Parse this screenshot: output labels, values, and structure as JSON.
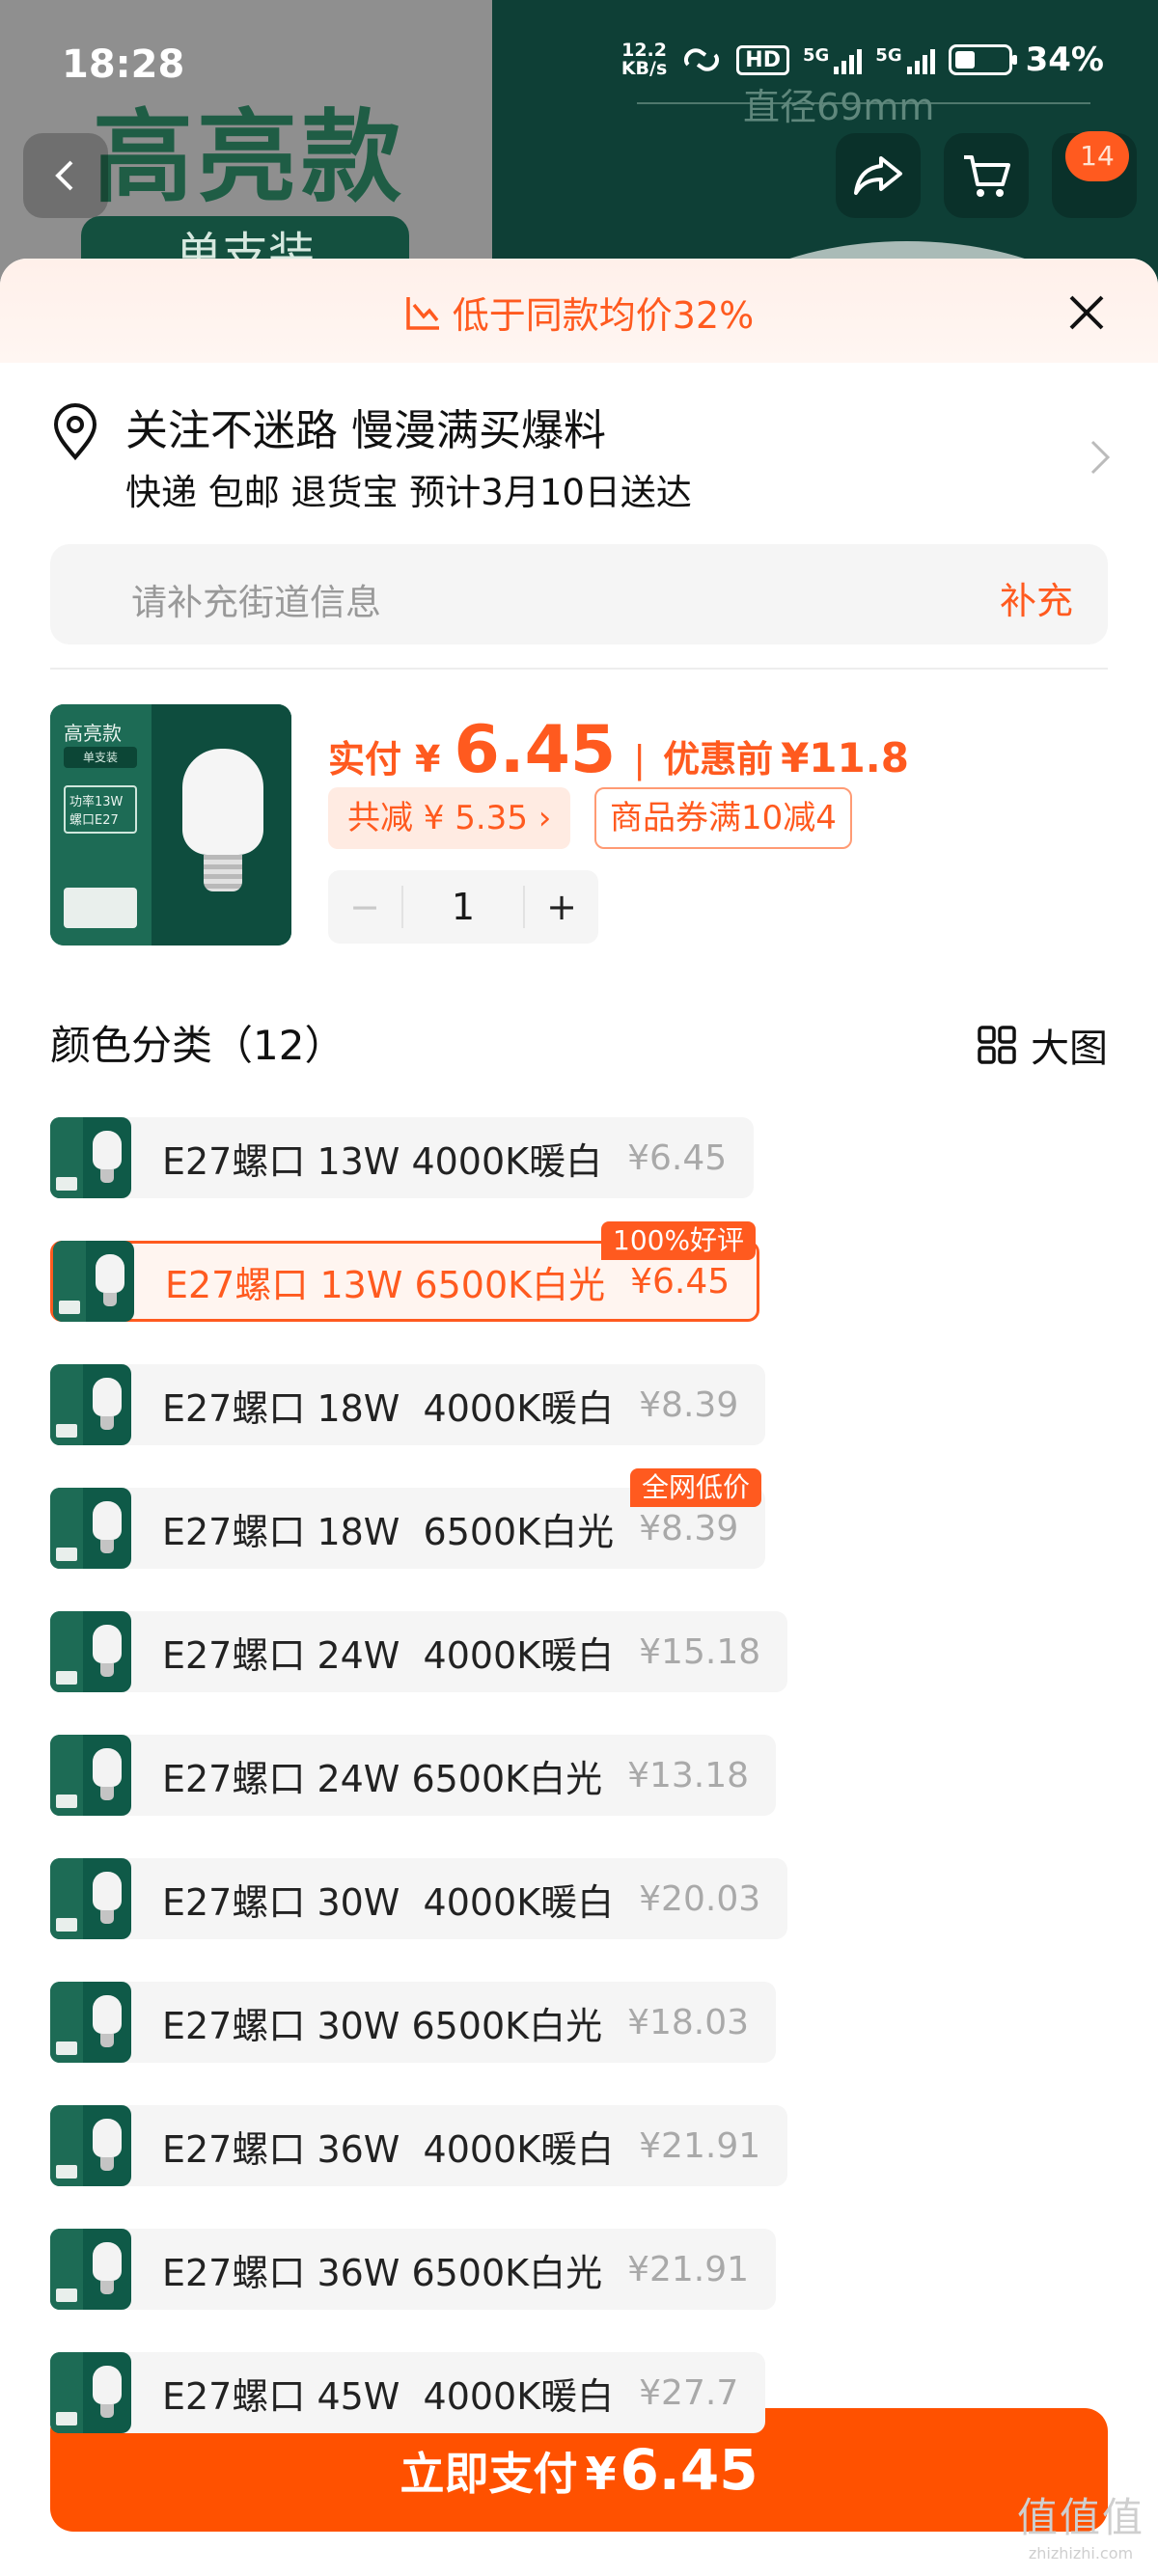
{
  "status_bar": {
    "time": "18:28",
    "net_speed_value": "12.2",
    "net_speed_unit": "KB/s",
    "hd_label": "HD",
    "signal_1_label": "5G",
    "signal_2_label": "5G",
    "battery": "34%"
  },
  "background_page": {
    "title": "高亮款",
    "badge": "单支装",
    "diameter": "直径69mm",
    "cart_count": "14"
  },
  "banner": {
    "text": "低于同款均价32%"
  },
  "address": {
    "title": "关注不迷路 慢漫满买爆料",
    "delivery": "快递 包邮 退货宝 预计3月10日送达",
    "street_placeholder": "请补充街道信息",
    "street_action": "补充"
  },
  "product": {
    "thumb_title": "高亮款",
    "thumb_badge": "单支装",
    "thumb_spec": "功率13W 螺口E27",
    "price_label": "实付",
    "price_yen": "¥",
    "price_value": "6.45",
    "separator": "|",
    "orig_label": "优惠前",
    "orig_value": "¥11.8",
    "discount_tag": "共减 ¥ 5.35 ›",
    "coupon_tag": "商品券满10减4",
    "quantity": "1",
    "minus": "−",
    "plus": "+"
  },
  "variants_section": {
    "title": "颜色分类（12）",
    "big_view_label": "大图"
  },
  "variants": [
    {
      "name": "E27螺口 13W 4000K暖白",
      "price": "¥6.45",
      "badge": ""
    },
    {
      "name": "E27螺口 13W 6500K白光",
      "price": "¥6.45",
      "badge": "100%好评"
    },
    {
      "name": "E27螺口 18W  4000K暖白",
      "price": "¥8.39",
      "badge": ""
    },
    {
      "name": "E27螺口 18W  6500K白光",
      "price": "¥8.39",
      "badge": "全网低价"
    },
    {
      "name": "E27螺口 24W  4000K暖白",
      "price": "¥15.18",
      "badge": ""
    },
    {
      "name": "E27螺口 24W 6500K白光",
      "price": "¥13.18",
      "badge": ""
    },
    {
      "name": "E27螺口 30W  4000K暖白",
      "price": "¥20.03",
      "badge": ""
    },
    {
      "name": "E27螺口 30W 6500K白光",
      "price": "¥18.03",
      "badge": ""
    },
    {
      "name": "E27螺口 36W  4000K暖白",
      "price": "¥21.91",
      "badge": ""
    },
    {
      "name": "E27螺口 36W 6500K白光",
      "price": "¥21.91",
      "badge": ""
    },
    {
      "name": "E27螺口 45W  4000K暖白",
      "price": "¥27.7",
      "badge": ""
    }
  ],
  "selected_variant_index": 1,
  "pay_button": {
    "label": "立即支付",
    "yen": "¥",
    "value": "6.45"
  },
  "watermark": {
    "logo": "值值值",
    "site": "zhizhizhi.com"
  },
  "colors": {
    "accent": "#ff5a1f",
    "pay_button": "#ff5100",
    "banner_bg": "#fff0ea",
    "background_green": "#0e3f36"
  },
  "icons": {
    "back": "back-arrow-icon",
    "share": "share-icon",
    "cart": "cart-icon",
    "banner": "trend-down-chart-icon",
    "close": "close-icon",
    "location": "location-pin-icon",
    "arrow": "chevron-right-icon",
    "grid": "grid-view-icon"
  }
}
